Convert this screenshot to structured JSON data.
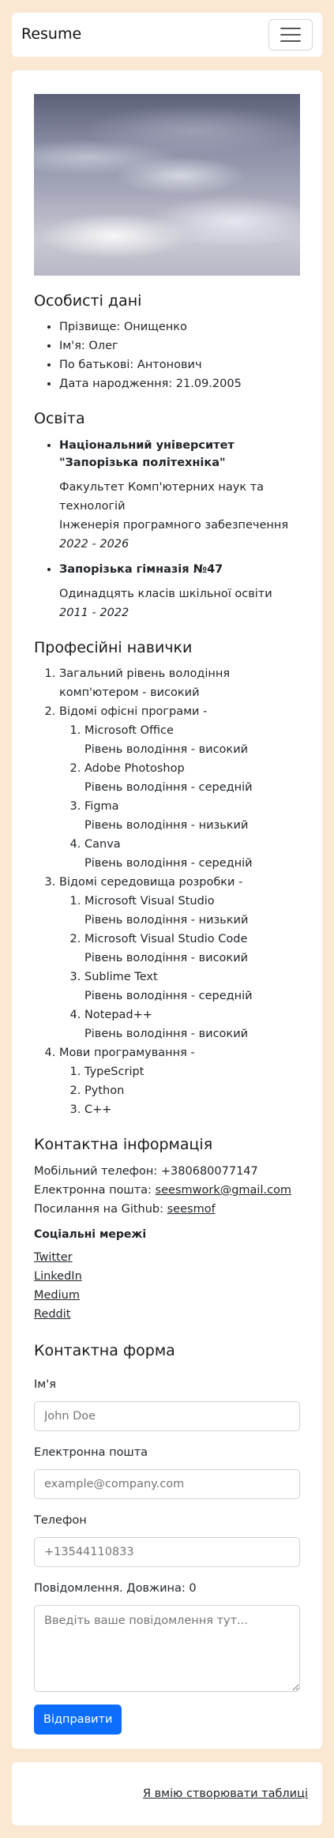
{
  "nav": {
    "brand": "Resume"
  },
  "personal": {
    "title": "Особисті дані",
    "items": [
      "Прізвище: Онищенко",
      "Ім'я: Олег",
      "По батькові: Антонович",
      "Дата народження: 21.09.2005"
    ]
  },
  "education": {
    "title": "Освіта",
    "items": [
      {
        "name": "Національний університет \"Запорізька політехніка\"",
        "faculty": "Факультет Комп'ютерних наук та технологій",
        "specialty": "Інженерія програмного забезпечення",
        "years": "2022 - 2026"
      },
      {
        "name": "Запорізька гімназія №47",
        "detail": "Одинадцять класів шкільної освіти",
        "years": "2011 - 2022"
      }
    ]
  },
  "skills": {
    "title": "Професійні навички",
    "computer": "Загальний рівень володіння комп'ютером - високий",
    "office_label": "Відомі офісні програми -",
    "office": [
      {
        "name": "Microsoft Office",
        "level": "Рівень володіння - високий"
      },
      {
        "name": "Adobe Photoshop",
        "level": "Рівень володіння - середній"
      },
      {
        "name": "Figma",
        "level": "Рівень володіння - низький"
      },
      {
        "name": "Canva",
        "level": "Рівень володіння - середній"
      }
    ],
    "ide_label": "Відомі середовища розробки -",
    "ide": [
      {
        "name": "Microsoft Visual Studio",
        "level": "Рівень володіння - низький"
      },
      {
        "name": "Microsoft Visual Studio Code",
        "level": "Рівень володіння - високий"
      },
      {
        "name": "Sublime Text",
        "level": "Рівень володіння - середній"
      },
      {
        "name": "Notepad++",
        "level": "Рівень володіння - високий"
      }
    ],
    "lang_label": "Мови програмування -",
    "langs": [
      "TypeScript",
      "Python",
      "C++"
    ]
  },
  "contact": {
    "title": "Контактна інформація",
    "phone_label": "Мобільний телефон: ",
    "phone": "+380680077147",
    "email_label": "Електронна пошта: ",
    "email": "seesmwork@gmail.com",
    "github_label": "Посилання на Github: ",
    "github": "seesmof",
    "social_title": "Соціальні мережі",
    "social": [
      "Twitter",
      "LinkedIn",
      "Medium",
      "Reddit"
    ]
  },
  "form": {
    "title": "Контактна форма",
    "name_label": "Ім'я",
    "name_placeholder": "John Doe",
    "email_label": "Електронна пошта",
    "email_placeholder": "example@company.com",
    "phone_label": "Телефон",
    "phone_placeholder": "+13544110833",
    "message_label": "Повідомлення. Довжина: 0",
    "message_placeholder": "Введіть ваше повідомлення тут...",
    "submit": "Відправити"
  },
  "footer": {
    "link": "Я вмію створювати таблиці"
  }
}
